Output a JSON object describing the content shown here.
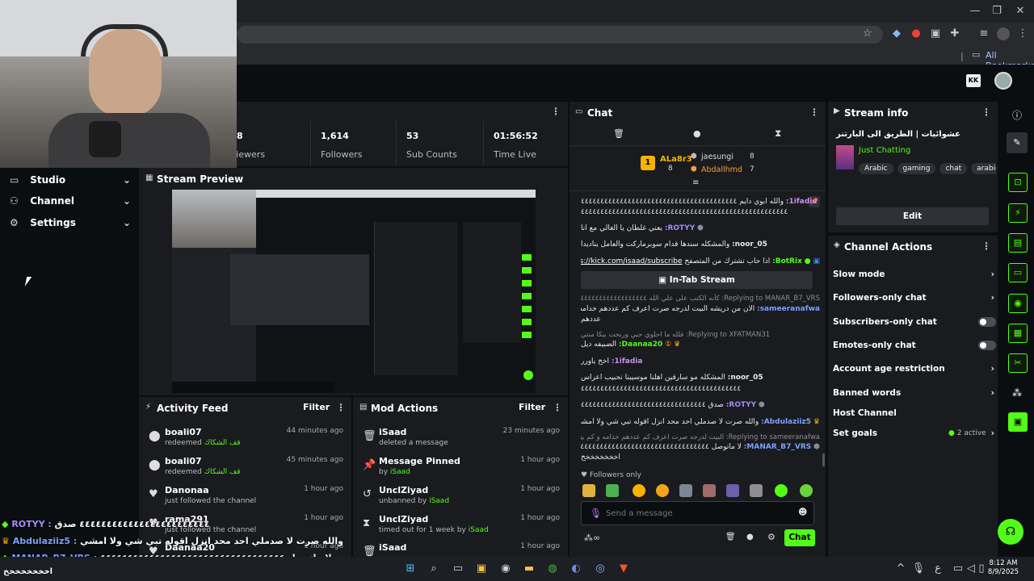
{
  "browser": {
    "bookmarks_label": "All Bookmarks",
    "min": "—",
    "max": "❐",
    "close": "✕"
  },
  "sidebar": {
    "items": [
      {
        "label": "Studio"
      },
      {
        "label": "Channel"
      },
      {
        "label": "Settings"
      }
    ]
  },
  "stats": [
    {
      "value": "8",
      "label": "Viewers"
    },
    {
      "value": "1,614",
      "label": "Followers"
    },
    {
      "value": "53",
      "label": "Sub Counts"
    },
    {
      "value": "01:56:52",
      "label": "Time Live"
    }
  ],
  "stream_preview": {
    "title": "Stream Preview"
  },
  "activity_feed": {
    "title": "Activity Feed",
    "filter": "Filter",
    "rows": [
      {
        "name": "boali07",
        "action": "redeemed",
        "reward": "قف الشكاك",
        "time": "44 minutes ago"
      },
      {
        "name": "boali07",
        "action": "redeemed",
        "reward": "قف الشكاك",
        "time": "45 minutes ago"
      },
      {
        "name": "Danonaa",
        "action": "just followed the channel",
        "reward": "",
        "time": "1 hour ago"
      },
      {
        "name": "rama291",
        "action": "just followed the channel",
        "reward": "",
        "time": "1 hour ago"
      },
      {
        "name": "Daanaa20",
        "action": "",
        "reward": "",
        "time": "1 hour ago"
      }
    ]
  },
  "mod_actions": {
    "title": "Mod Actions",
    "filter": "Filter",
    "rows": [
      {
        "name": "iSaad",
        "desc": "deleted a message",
        "by": "",
        "time": "23 minutes ago"
      },
      {
        "name": "Message Pinned",
        "desc": "by",
        "by": "iSaad",
        "time": "1 hour ago"
      },
      {
        "name": "UnclZiyad",
        "desc": "unbanned by",
        "by": "iSaad",
        "time": "1 hour ago"
      },
      {
        "name": "UnclZiyad",
        "desc": "timed out for 1 week by",
        "by": "iSaad",
        "time": "1 hour ago"
      },
      {
        "name": "iSaad",
        "desc": "",
        "by": "",
        "time": "1 hour ago"
      }
    ]
  },
  "chat": {
    "title": "Chat",
    "leaderboard": [
      {
        "rank": "1",
        "name": "ALa8r3",
        "count": "8"
      },
      {
        "rank": "",
        "name": "jaesungi",
        "count": "8"
      },
      {
        "rank": "",
        "name": "Abdallhmd",
        "count": "7"
      }
    ],
    "in_tab_stream": "In-Tab Stream",
    "followers_only": "Followers only",
    "send_placeholder": "Send a message",
    "send_button": "Chat",
    "messages": [
      {
        "user": "1ifadia:",
        "text": "والله ابوي دايم ٤٤٤٤٤٤٤٤٤٤٤٤٤٤٤٤٤٤٤٤٤٤٤٤٤٤٤٤٤٤٤٤٤٤٤٤٤٤٤٤",
        "color": "#c792ea"
      },
      {
        "user": "",
        "text": "٤٤٤٤٤٤٤٤٤٤٤٤٤٤٤٤٤٤٤٤٤٤٤٤٤٤٤٤٤٤٤٤٤٤٤٤٤٤٤٤٤٤٤٤٤٤٤٤٤٤٤٤٤",
        "color": "#e8e8e8"
      },
      {
        "user": "ROTYY:",
        "text": "يعني غلطان يا الغالي مع انا",
        "color": "#a78bfa"
      },
      {
        "user": "noor_05:",
        "text": "والمشكله سندها قدام سوبرماركت والعامل يناديدا",
        "color": "#ffffff"
      },
      {
        "user": "BotRix:",
        "text": "اذا حاب تشترك من المتصفح",
        "link": "https://kick.com/isaad/subscribe",
        "color": "#53fc18"
      },
      {
        "user": "",
        "text": "Replying to MANAR_B7_VRS: كأنه الكتب على علي الله ٤٤٤٤٤٤٤٤٤٤٤٤٤٤٤٤٤٤٤",
        "color": "#8a8d92"
      },
      {
        "user": "sameeranafwa:",
        "text": "الان من دريشه البيت لدرجه صرت اعرف كم عددهم خدامه و كم يزر",
        "color": "#7aa2f7"
      },
      {
        "user": "",
        "text": "عددهم",
        "color": "#e8e8e8"
      },
      {
        "user": "",
        "text": "Replying to XFATMAN31: فلله ما احلوي حبي وربحت بيكا منتي",
        "color": "#8a8d92"
      },
      {
        "user": "Daanaa20:",
        "text": "الضبيفه ديل",
        "color": "#53fc18"
      },
      {
        "user": "1ifadia:",
        "text": "اخخ ياورر",
        "color": "#c792ea"
      },
      {
        "user": "noor_05:",
        "text": "المشكله مو سارقين اهلنا موسيبنا نحبيب اعراس",
        "color": "#ffffff"
      },
      {
        "user": "",
        "text": "٤٤٤٤٤٤٤٤٤٤٤٤٤٤٤٤٤٤٤٤٤٤٤٤٤٤٤٤٤٤٤٤٤٤٤٤٤٤٤٤٤",
        "color": "#e8e8e8"
      },
      {
        "user": "ROTYY:",
        "text": "صدق ٤٤٤٤٤٤٤٤٤٤٤٤٤٤٤٤٤٤٤٤٤٤٤٤٤٤٤٤٤٤٤٤",
        "color": "#a78bfa"
      },
      {
        "user": "Abdulaziiz5:",
        "text": "والله صرت لا صدملي احد محد انزل اقوله تبي شي ولا امشي",
        "color": "#7aa2f7"
      },
      {
        "user": "",
        "text": "Replying to sameeranafwa: البيت لدرجه صرت اعرف كم عددهم خدامه و كم يزر عددهم",
        "color": "#8a8d92"
      },
      {
        "user": "MANAR_B7_VRS:",
        "text": "لا ماتوصل ٤٤٤٤٤٤٤٤٤٤٤٤٤٤٤٤٤٤٤٤٤٤٤٤٤٤٤٤٤٤٤٤٤",
        "color": "#7aa2f7"
      },
      {
        "user": "",
        "text": "اخخخخخخخخ",
        "color": "#e8e8e8"
      }
    ]
  },
  "stream_info": {
    "title": "Stream info",
    "stream_title": "عشوائيات | الطريق الى البارتنر",
    "category": "Just Chatting",
    "tags": [
      "Arabic",
      "gaming",
      "chat",
      "arabic"
    ],
    "edit": "Edit"
  },
  "channel_actions": {
    "title": "Channel Actions",
    "rows": [
      {
        "label": "Slow mode",
        "kind": "chevron"
      },
      {
        "label": "Followers-only chat",
        "kind": "chevron"
      },
      {
        "label": "Subscribers-only chat",
        "kind": "toggle"
      },
      {
        "label": "Emotes-only chat",
        "kind": "toggle"
      },
      {
        "label": "Account age restriction",
        "kind": "chevron"
      },
      {
        "label": "Banned words",
        "kind": "chevron"
      },
      {
        "label": "Host Channel",
        "kind": "none"
      },
      {
        "label": "Set goals",
        "kind": "chevron",
        "extra": "2 active"
      }
    ]
  },
  "overlay": [
    {
      "user": "ROTYY :",
      "text": "٤٤٤٤٤٤٤٤٤٤٤٤٤٤٤٤٤٤٤٤٤٤٤٤ صدق",
      "color": "#a78bfa"
    },
    {
      "user": "Abdulaziiz5 :",
      "text": "والله صرت لا صدملي احد محد انزل اقوله تبي شي ولا امشي",
      "color": "#7aa2f7"
    },
    {
      "user": "MANAR_B7_VRS :",
      "text": "لا ماتوصل ٤٤٤٤٤٤٤٤٤٤٤٤٤٤٤٤٤٤٤٤٤٤٤٤٤٤٤٤٤٤٤٤٤٤",
      "color": "#7aa2f7"
    },
    {
      "user": "",
      "text": "اخخخخخخخخ",
      "color": "#ffffff"
    }
  ],
  "taskbar": {
    "time": "8:12 AM",
    "date": "8/9/2025",
    "lang": "ع"
  },
  "colors": {
    "accent": "#53fc18",
    "panel": "#191b1f",
    "bg": "#0b0e11"
  }
}
